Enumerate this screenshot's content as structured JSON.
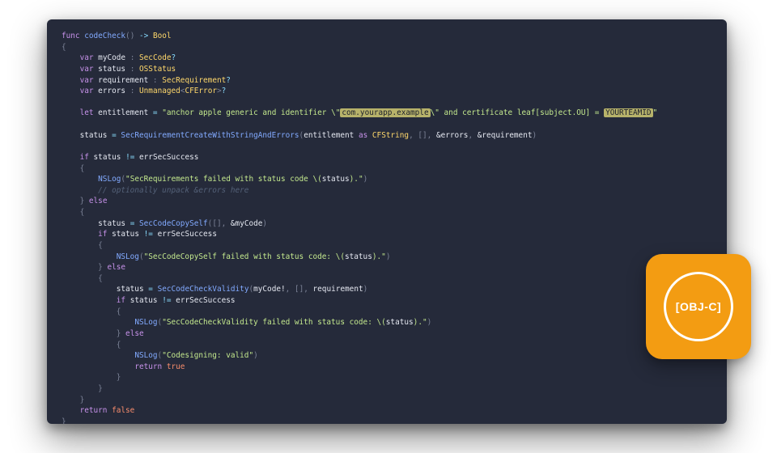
{
  "badge": {
    "label": "[OBJ-C]"
  },
  "code": {
    "func_kw": "func",
    "func_name": "codeCheck",
    "arrow": "->",
    "return_type": "Bool",
    "var_kw": "var",
    "let_kw": "let",
    "decl_myCode": "myCode",
    "type_SecCode": "SecCode",
    "decl_status": "status",
    "type_OSStatus": "OSStatus",
    "decl_requirement": "requirement",
    "type_SecRequirement": "SecRequirement",
    "decl_errors": "errors",
    "type_Unmanaged": "Unmanaged",
    "type_CFError": "CFError",
    "entitlement_name": "entitlement",
    "entitlement_str_a": "\"anchor apple generic and identifier \\\"",
    "entitlement_hl_1": "com.yourapp.example",
    "entitlement_str_b": "\\\" and certificate leaf[subject.OU] = ",
    "entitlement_hl_2": "YOURTEAMID",
    "entitlement_str_c": "\"",
    "fn_reqcreate": "SecRequirementCreateWithStringAndErrors",
    "as_kw": "as",
    "type_CFString": "CFString",
    "arg_errors": "&errors",
    "arg_requirement": "&requirement",
    "if_kw": "if",
    "else_kw": "else",
    "neq": "!=",
    "errSecSuccess": "errSecSuccess",
    "fn_nslog": "NSLog",
    "str_req_failed_a": "\"SecRequirements failed with status code ",
    "interp_open": "\\(",
    "interp_status": "status",
    "interp_close": ")",
    "str_tail_dotq": ".\"",
    "cmt_unpack": "// optionally unpack &errors here",
    "fn_copyself": "SecCodeCopySelf",
    "arg_myCode": "&myCode",
    "str_copy_failed_a": "\"SecCodeCopySelf failed with status code: ",
    "fn_checkvalid": "SecCodeCheckValidity",
    "myCode_bang": "myCode!",
    "requirement_plain": "requirement",
    "str_check_failed_a": "\"SecCodeCheckValidity failed with status code: ",
    "str_valid": "\"Codesigning: valid\"",
    "return_kw": "return",
    "true_lit": "true",
    "false_lit": "false"
  }
}
